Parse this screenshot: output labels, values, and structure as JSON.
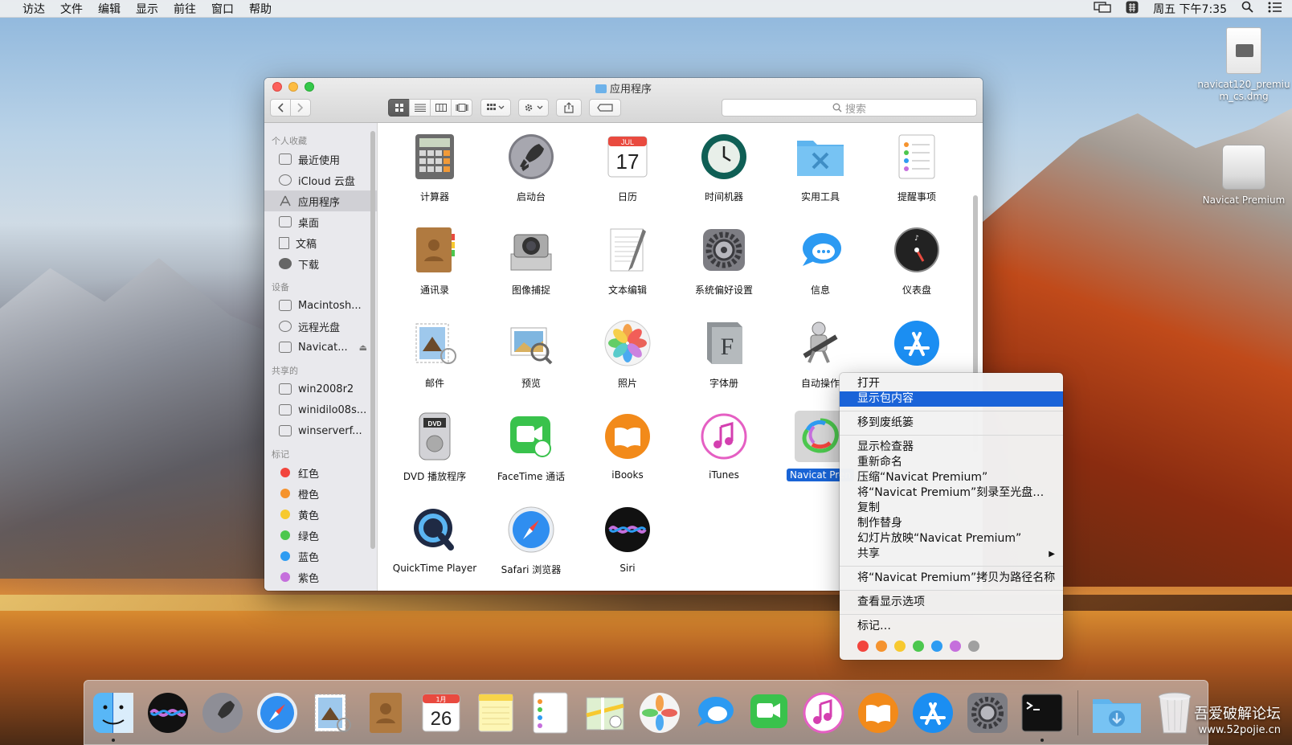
{
  "menubar": {
    "apple": "",
    "items": [
      "访达",
      "文件",
      "编辑",
      "显示",
      "前往",
      "窗口",
      "帮助"
    ],
    "clock": "周五 下午7:35"
  },
  "desktop": {
    "icons": [
      {
        "label": "navicat120_premium_cs.dmg"
      },
      {
        "label": "Navicat Premium"
      }
    ]
  },
  "finder": {
    "title": "应用程序",
    "search_placeholder": "搜索",
    "sidebar": {
      "sections": [
        {
          "header": "个人收藏",
          "items": [
            "最近使用",
            "iCloud 云盘",
            "应用程序",
            "桌面",
            "文稿",
            "下载"
          ]
        },
        {
          "header": "设备",
          "items": [
            "Macintosh...",
            "远程光盘",
            "Navicat..."
          ]
        },
        {
          "header": "共享的",
          "items": [
            "win2008r2",
            "winidilo08s...",
            "winserverf..."
          ]
        },
        {
          "header": "标记",
          "items": [
            "红色",
            "橙色",
            "黄色",
            "绿色",
            "蓝色",
            "紫色"
          ]
        }
      ],
      "tag_colors": [
        "#f2453d",
        "#f5932e",
        "#f7c92f",
        "#4cc74e",
        "#2e9cf2",
        "#c56fdc"
      ]
    },
    "apps": [
      "计算器",
      "启动台",
      "日历",
      "时间机器",
      "实用工具",
      "提醒事项",
      "通讯录",
      "图像捕捉",
      "文本编辑",
      "系统偏好设置",
      "信息",
      "仪表盘",
      "邮件",
      "预览",
      "照片",
      "字体册",
      "自动操作",
      "",
      "DVD 播放程序",
      "FaceTime 通话",
      "iBooks",
      "iTunes",
      "Navicat Pren",
      "QuickTime Player",
      "Safari 浏览器",
      "Siri"
    ],
    "calendar": {
      "month": "JUL",
      "day": "17"
    }
  },
  "context_menu": {
    "items": [
      "打开",
      "显示包内容",
      "移到废纸篓",
      "显示检查器",
      "重新命名",
      "压缩“Navicat Premium”",
      "将“Navicat Premium”刻录至光盘…",
      "复制",
      "制作替身",
      "幻灯片放映“Navicat Premium”",
      "共享",
      "将“Navicat Premium”拷贝为路径名称",
      "查看显示选项",
      "标记…"
    ],
    "tag_colors": [
      "#f2453d",
      "#f5932e",
      "#f7c92f",
      "#4cc74e",
      "#2e9cf2",
      "#c56fdc",
      "#a0a0a0"
    ]
  },
  "dock": {
    "calendar": {
      "month": "1月",
      "day": "26"
    }
  },
  "watermark": {
    "line1": "吾爱破解论坛",
    "line2": "www.52pojie.cn"
  }
}
